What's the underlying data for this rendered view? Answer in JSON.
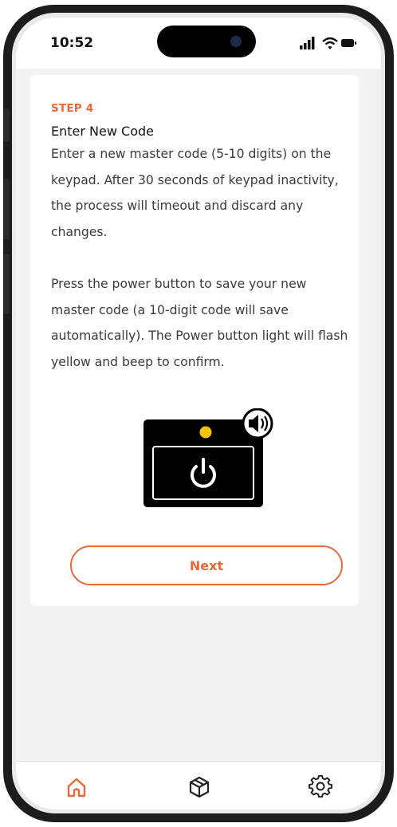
{
  "status_bar": {
    "time": "10:52"
  },
  "step": {
    "label": "STEP 4",
    "title": "Enter New Code",
    "paragraph1": "Enter a new master code (5-10 digits) on the keypad. After 30 seconds of keypad inactivity, the process will timeout and discard any changes.",
    "paragraph2": "Press the power button to save your new master code (a 10-digit code will save automatically). The Power button light will flash yellow and beep to confirm."
  },
  "actions": {
    "next_label": "Next"
  },
  "tab_bar": {
    "tabs": [
      {
        "icon": "home-icon",
        "active": true
      },
      {
        "icon": "package-icon",
        "active": false
      },
      {
        "icon": "gear-icon",
        "active": false
      }
    ]
  },
  "colors": {
    "accent": "#e8683c",
    "light": "#f5c400",
    "keypad": "#000000"
  }
}
